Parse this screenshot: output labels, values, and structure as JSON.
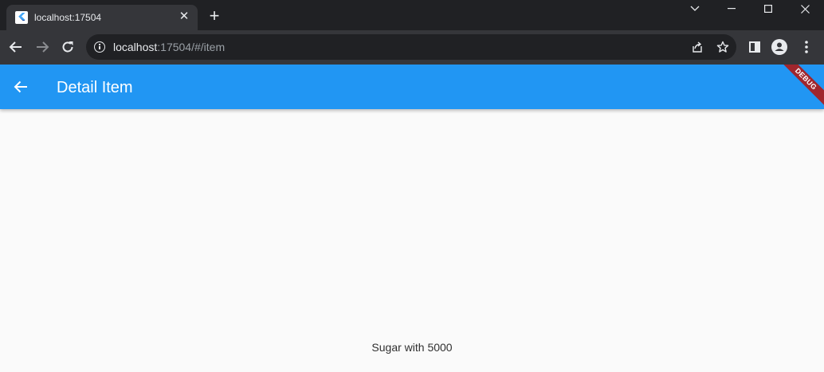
{
  "browser": {
    "tab_title": "localhost:17504",
    "tab_close_glyph": "✕",
    "new_tab_glyph": "+",
    "url_host": "localhost",
    "url_rest": ":17504/#/item",
    "icons": [
      "back-arrow-icon",
      "forward-arrow-icon",
      "reload-icon",
      "info-icon",
      "share-icon",
      "star-icon",
      "side-panel-icon",
      "profile-icon",
      "menu-kebab-icon"
    ],
    "colors": {
      "titlebar": "#202124",
      "toolbar": "#35363a",
      "omnibox": "#202124"
    }
  },
  "app": {
    "appbar_title": "Detail Item",
    "debug_banner": "DEBUG",
    "body_text": "Sugar with 5000",
    "colors": {
      "appbar": "#2196f3",
      "debug_banner": "#a0262d",
      "background": "#fafafa"
    }
  }
}
